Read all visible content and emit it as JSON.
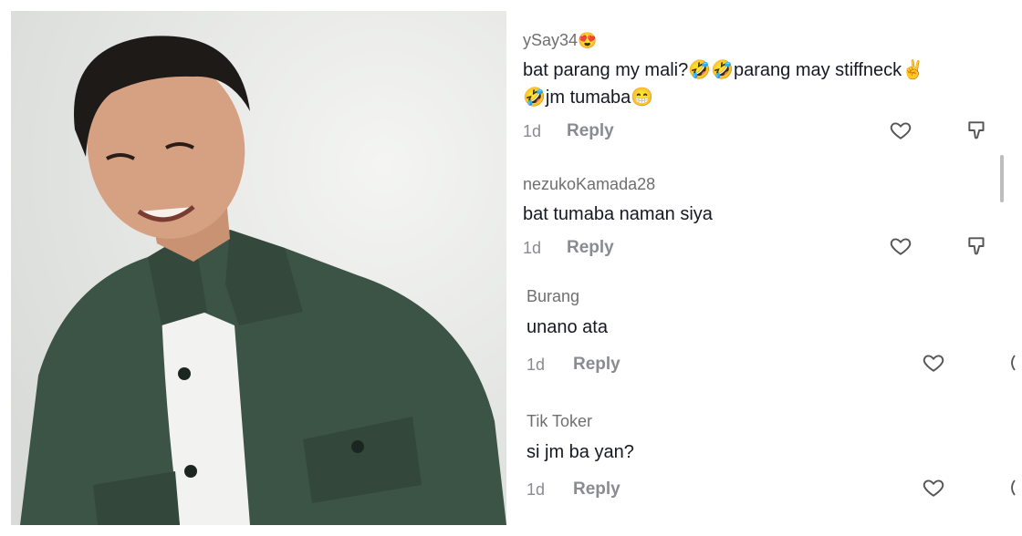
{
  "comments": [
    {
      "username": "ySay34",
      "username_emoji": "😍",
      "lines": [
        "bat parang my mali?🤣🤣parang may stiffneck✌️",
        "🤣jm tumaba😁"
      ],
      "time": "1d",
      "reply_label": "Reply"
    },
    {
      "username": "nezukoKamada28",
      "username_emoji": "",
      "lines": [
        "bat tumaba naman siya"
      ],
      "time": "1d",
      "reply_label": "Reply"
    },
    {
      "username": "Burang",
      "username_emoji": "",
      "lines": [
        "unano ata"
      ],
      "time": "1d",
      "reply_label": "Reply"
    },
    {
      "username": "Tik Toker",
      "username_emoji": "",
      "lines": [
        "si jm ba yan?"
      ],
      "time": "1d",
      "reply_label": "Reply"
    }
  ],
  "icons": {
    "like": "heart-icon",
    "dislike": "thumbs-down-icon"
  },
  "colors": {
    "jacket": "#3b5445",
    "background": "#e6e7e4",
    "username": "#6f6f6f",
    "comment_text": "#161823",
    "meta_text": "#8a8b91"
  }
}
